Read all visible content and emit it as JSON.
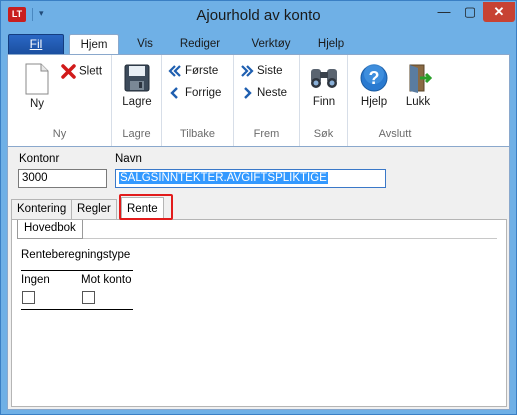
{
  "window": {
    "title": "Ajourhold av konto",
    "app_logo": "LT",
    "min_glyph": "—",
    "max_glyph": "▢",
    "close_glyph": "✕"
  },
  "ribbon_tabs": {
    "file": "Fil",
    "items": [
      "Hjem",
      "Vis",
      "Rediger",
      "Verktøy",
      "Hjelp"
    ],
    "active": "Hjem"
  },
  "ribbon": {
    "groups": {
      "ny": {
        "label": "Ny",
        "new_label": "Ny",
        "delete_label": "Slett"
      },
      "lagre": {
        "label": "Lagre",
        "save_label": "Lagre"
      },
      "tilbake": {
        "label": "Tilbake",
        "first_label": "Første",
        "prev_label": "Forrige"
      },
      "frem": {
        "label": "Frem",
        "last_label": "Siste",
        "next_label": "Neste"
      },
      "sok": {
        "label": "Søk",
        "find_label": "Finn"
      },
      "avslutt": {
        "label": "Avslutt",
        "help_label": "Hjelp",
        "close_label": "Lukk"
      }
    }
  },
  "form": {
    "kontonr_label": "Kontonr",
    "kontonr_value": "3000",
    "navn_label": "Navn",
    "navn_value": "SALGSINNTEKTER.AVGIFTSPLIKTIGE"
  },
  "tabs": {
    "items": [
      "Kontering",
      "Regler",
      "Rente"
    ],
    "active": "Rente"
  },
  "rente": {
    "subtab": "Hovedbok",
    "section_label": "Renteberegningstype",
    "col_ingen": "Ingen",
    "col_mot_konto": "Mot konto",
    "ingen_checked": false,
    "mot_konto_checked": false
  }
}
